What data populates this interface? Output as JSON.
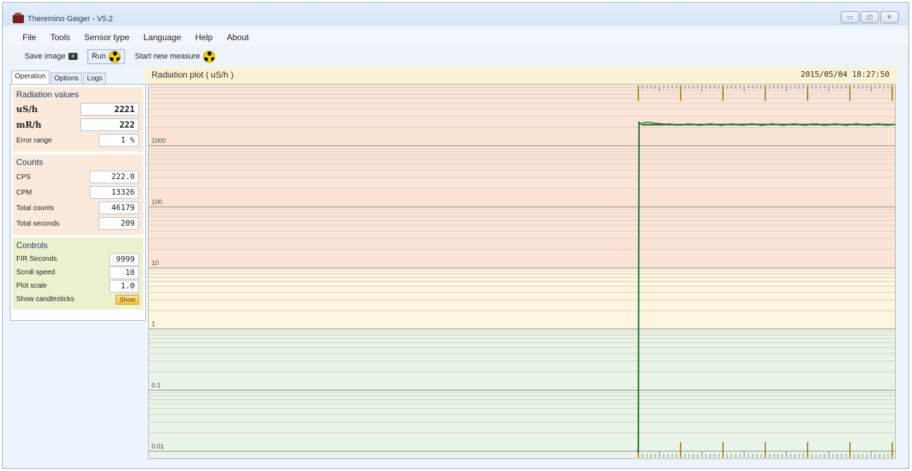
{
  "window": {
    "title": "Theremino Geiger - V5.2",
    "controls": [
      "minimize",
      "maximize",
      "close"
    ]
  },
  "menu": [
    "File",
    "Tools",
    "Sensor type",
    "Language",
    "Help",
    "About"
  ],
  "toolbar": {
    "save_image": "Save image",
    "run": "Run",
    "start_new": "Start new measure"
  },
  "tabs": [
    "Operation",
    "Options",
    "Logs"
  ],
  "radiation": {
    "title": "Radiation values",
    "usv_label": "uS/h",
    "usv_value": "2221",
    "mr_label": "mR/h",
    "mr_value": "222",
    "err_label": "Error range",
    "err_value": "1 %"
  },
  "counts": {
    "title": "Counts",
    "cps_label": "CPS",
    "cps_value": "222.0",
    "cpm_label": "CPM",
    "cpm_value": "13326",
    "total_label": "Total counts",
    "total_value": "46179",
    "secs_label": "Total seconds",
    "secs_value": "209"
  },
  "controls": {
    "title": "Controls",
    "fir_label": "FIR Seconds",
    "fir_value": "9999",
    "scroll_label": "Scroll speed",
    "scroll_value": "10",
    "scale_label": "Plot scale",
    "scale_value": "1.0",
    "candle_label": "Show candlesticks",
    "candle_button": "Show"
  },
  "plot": {
    "title": "Radiation plot ( uS/h )",
    "timestamp": "2015/05/04 18:27:50"
  },
  "colors": {
    "accent": "#f3d600",
    "trace": "#1f6b2a",
    "band_high": "#fbe4d6",
    "band_mid": "#fbf6dc",
    "band_low": "#e8f4e7"
  },
  "chart_data": {
    "type": "line",
    "title": "Radiation plot ( uS/h )",
    "ylabel": "uS/h",
    "yscale": "log",
    "ylim": [
      0.01,
      10000
    ],
    "y_ticks": [
      "1000",
      "100",
      "10",
      "1",
      "0.1",
      "0.01"
    ],
    "series": [
      {
        "values": [
          0.01,
          0.01,
          2400,
          2200,
          2210,
          2230,
          2221,
          2221
        ]
      }
    ],
    "grid": true
  }
}
